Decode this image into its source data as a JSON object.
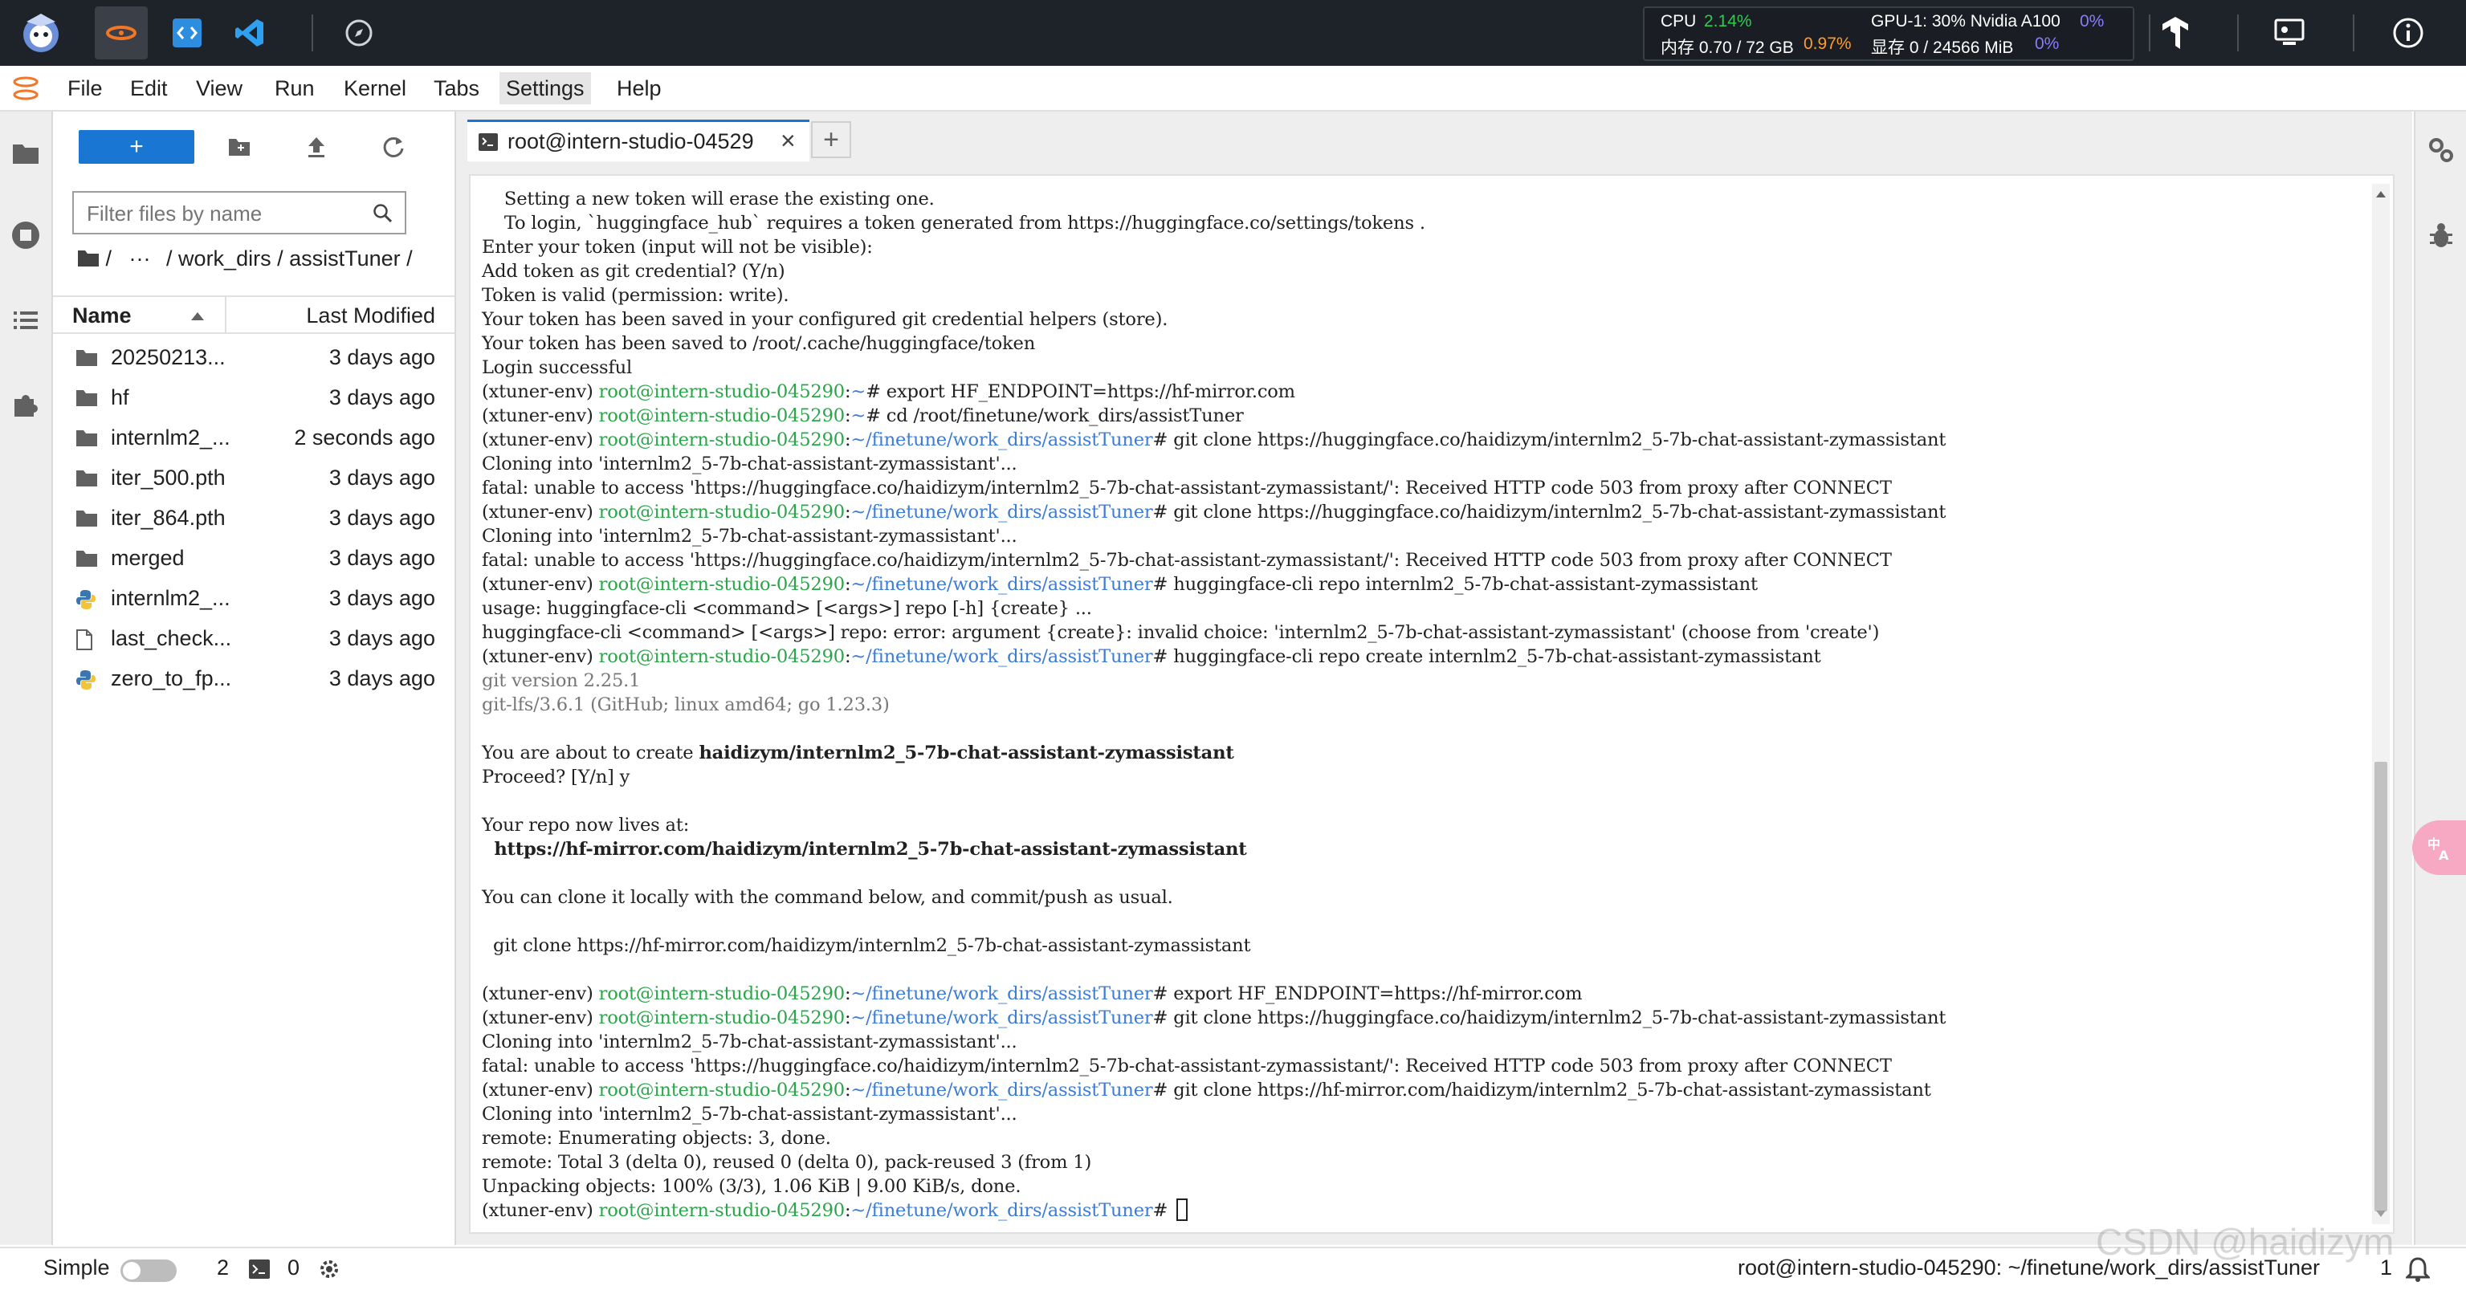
{
  "topbar": {
    "monitor": {
      "cpu_label": "CPU",
      "cpu_value": "2.14%",
      "mem_label": "内存 0.70 / 72 GB",
      "mem_value": "0.97%",
      "gpu_label": "GPU-1: 30% Nvidia A100",
      "gpu_value": "0%",
      "vram_label": "显存 0 / 24566 MiB",
      "vram_value": "0%"
    }
  },
  "menubar": {
    "items": [
      "File",
      "Edit",
      "View",
      "Run",
      "Kernel",
      "Tabs",
      "Settings",
      "Help"
    ]
  },
  "filebrowser": {
    "new_label": "+",
    "filter_placeholder": "Filter files by name",
    "breadcrumb": {
      "root": "/",
      "ellipsis": "···",
      "path": "/ work_dirs / assistTuner /"
    },
    "columns": {
      "name": "Name",
      "modified": "Last Modified"
    },
    "files": [
      {
        "name": "20250213...",
        "modified": "3 days ago",
        "type": "folder"
      },
      {
        "name": "hf",
        "modified": "3 days ago",
        "type": "folder"
      },
      {
        "name": "internlm2_...",
        "modified": "2 seconds ago",
        "type": "folder"
      },
      {
        "name": "iter_500.pth",
        "modified": "3 days ago",
        "type": "folder"
      },
      {
        "name": "iter_864.pth",
        "modified": "3 days ago",
        "type": "folder"
      },
      {
        "name": "merged",
        "modified": "3 days ago",
        "type": "folder"
      },
      {
        "name": "internlm2_...",
        "modified": "3 days ago",
        "type": "python"
      },
      {
        "name": "last_check...",
        "modified": "3 days ago",
        "type": "file"
      },
      {
        "name": "zero_to_fp...",
        "modified": "3 days ago",
        "type": "python"
      }
    ]
  },
  "main": {
    "tab_label": "root@intern-studio-04529",
    "tab_close": "×",
    "tab_add": "+"
  },
  "terminal": {
    "lines": [
      [
        {
          "t": "    Setting a new token will erase the existing one.",
          "c": "cmd"
        }
      ],
      [
        {
          "t": "    To login, `huggingface_hub` requires a token generated from https://huggingface.co/settings/tokens .",
          "c": "cmd"
        }
      ],
      [
        {
          "t": "Enter your token (input will not be visible):",
          "c": "cmd"
        }
      ],
      [
        {
          "t": "Add token as git credential? (Y/n)",
          "c": "cmd"
        }
      ],
      [
        {
          "t": "Token is valid (permission: write).",
          "c": "cmd"
        }
      ],
      [
        {
          "t": "Your token has been saved in your configured git credential helpers (store).",
          "c": "cmd"
        }
      ],
      [
        {
          "t": "Your token has been saved to /root/.cache/huggingface/token",
          "c": "cmd"
        }
      ],
      [
        {
          "t": "Login successful",
          "c": "cmd"
        }
      ],
      [
        {
          "t": "(xtuner-env) ",
          "c": "env"
        },
        {
          "t": "root@intern-studio-045290",
          "c": "usr"
        },
        {
          "t": ":",
          "c": "cmd"
        },
        {
          "t": "~",
          "c": "pth"
        },
        {
          "t": "# export HF_ENDPOINT=https://hf-mirror.com",
          "c": "cmd"
        }
      ],
      [
        {
          "t": "(xtuner-env) ",
          "c": "env"
        },
        {
          "t": "root@intern-studio-045290",
          "c": "usr"
        },
        {
          "t": ":",
          "c": "cmd"
        },
        {
          "t": "~",
          "c": "pth"
        },
        {
          "t": "# cd /root/finetune/work_dirs/assistTuner",
          "c": "cmd"
        }
      ],
      [
        {
          "t": "(xtuner-env) ",
          "c": "env"
        },
        {
          "t": "root@intern-studio-045290",
          "c": "usr"
        },
        {
          "t": ":",
          "c": "cmd"
        },
        {
          "t": "~/finetune/work_dirs/assistTuner",
          "c": "pth"
        },
        {
          "t": "# git clone https://huggingface.co/haidizym/internlm2_5-7b-chat-assistant-zymassistant",
          "c": "cmd"
        }
      ],
      [
        {
          "t": "Cloning into 'internlm2_5-7b-chat-assistant-zymassistant'...",
          "c": "cmd"
        }
      ],
      [
        {
          "t": "fatal: unable to access 'https://huggingface.co/haidizym/internlm2_5-7b-chat-assistant-zymassistant/': Received HTTP code 503 from proxy after CONNECT",
          "c": "cmd"
        }
      ],
      [
        {
          "t": "(xtuner-env) ",
          "c": "env"
        },
        {
          "t": "root@intern-studio-045290",
          "c": "usr"
        },
        {
          "t": ":",
          "c": "cmd"
        },
        {
          "t": "~/finetune/work_dirs/assistTuner",
          "c": "pth"
        },
        {
          "t": "# git clone https://huggingface.co/haidizym/internlm2_5-7b-chat-assistant-zymassistant",
          "c": "cmd"
        }
      ],
      [
        {
          "t": "Cloning into 'internlm2_5-7b-chat-assistant-zymassistant'...",
          "c": "cmd"
        }
      ],
      [
        {
          "t": "fatal: unable to access 'https://huggingface.co/haidizym/internlm2_5-7b-chat-assistant-zymassistant/': Received HTTP code 503 from proxy after CONNECT",
          "c": "cmd"
        }
      ],
      [
        {
          "t": "(xtuner-env) ",
          "c": "env"
        },
        {
          "t": "root@intern-studio-045290",
          "c": "usr"
        },
        {
          "t": ":",
          "c": "cmd"
        },
        {
          "t": "~/finetune/work_dirs/assistTuner",
          "c": "pth"
        },
        {
          "t": "# huggingface-cli repo internlm2_5-7b-chat-assistant-zymassistant",
          "c": "cmd"
        }
      ],
      [
        {
          "t": "usage: huggingface-cli <command> [<args>] repo [-h] {create} ...",
          "c": "cmd"
        }
      ],
      [
        {
          "t": "huggingface-cli <command> [<args>] repo: error: argument {create}: invalid choice: 'internlm2_5-7b-chat-assistant-zymassistant' (choose from 'create')",
          "c": "cmd"
        }
      ],
      [
        {
          "t": "(xtuner-env) ",
          "c": "env"
        },
        {
          "t": "root@intern-studio-045290",
          "c": "usr"
        },
        {
          "t": ":",
          "c": "cmd"
        },
        {
          "t": "~/finetune/work_dirs/assistTuner",
          "c": "pth"
        },
        {
          "t": "# huggingface-cli repo create internlm2_5-7b-chat-assistant-zymassistant",
          "c": "cmd"
        }
      ],
      [
        {
          "t": "git version 2.25.1",
          "c": "dim"
        }
      ],
      [
        {
          "t": "git-lfs/3.6.1 (GitHub; linux amd64; go 1.23.3)",
          "c": "dim"
        }
      ],
      [
        {
          "t": "",
          "c": "cmd"
        }
      ],
      [
        {
          "t": "You are about to create ",
          "c": "cmd"
        },
        {
          "t": "haidizym/internlm2_5-7b-chat-assistant-zymassistant",
          "c": "bld"
        }
      ],
      [
        {
          "t": "Proceed? [Y/n] y",
          "c": "cmd"
        }
      ],
      [
        {
          "t": "",
          "c": "cmd"
        }
      ],
      [
        {
          "t": "Your repo now lives at:",
          "c": "cmd"
        }
      ],
      [
        {
          "t": "  https://hf-mirror.com/haidizym/internlm2_5-7b-chat-assistant-zymassistant",
          "c": "bld"
        }
      ],
      [
        {
          "t": "",
          "c": "cmd"
        }
      ],
      [
        {
          "t": "You can clone it locally with the command below, and commit/push as usual.",
          "c": "cmd"
        }
      ],
      [
        {
          "t": "",
          "c": "cmd"
        }
      ],
      [
        {
          "t": "  git clone https://hf-mirror.com/haidizym/internlm2_5-7b-chat-assistant-zymassistant",
          "c": "cmd"
        }
      ],
      [
        {
          "t": "",
          "c": "cmd"
        }
      ],
      [
        {
          "t": "(xtuner-env) ",
          "c": "env"
        },
        {
          "t": "root@intern-studio-045290",
          "c": "usr"
        },
        {
          "t": ":",
          "c": "cmd"
        },
        {
          "t": "~/finetune/work_dirs/assistTuner",
          "c": "pth"
        },
        {
          "t": "# export HF_ENDPOINT=https://hf-mirror.com",
          "c": "cmd"
        }
      ],
      [
        {
          "t": "(xtuner-env) ",
          "c": "env"
        },
        {
          "t": "root@intern-studio-045290",
          "c": "usr"
        },
        {
          "t": ":",
          "c": "cmd"
        },
        {
          "t": "~/finetune/work_dirs/assistTuner",
          "c": "pth"
        },
        {
          "t": "# git clone https://huggingface.co/haidizym/internlm2_5-7b-chat-assistant-zymassistant",
          "c": "cmd"
        }
      ],
      [
        {
          "t": "Cloning into 'internlm2_5-7b-chat-assistant-zymassistant'...",
          "c": "cmd"
        }
      ],
      [
        {
          "t": "fatal: unable to access 'https://huggingface.co/haidizym/internlm2_5-7b-chat-assistant-zymassistant/': Received HTTP code 503 from proxy after CONNECT",
          "c": "cmd"
        }
      ],
      [
        {
          "t": "(xtuner-env) ",
          "c": "env"
        },
        {
          "t": "root@intern-studio-045290",
          "c": "usr"
        },
        {
          "t": ":",
          "c": "cmd"
        },
        {
          "t": "~/finetune/work_dirs/assistTuner",
          "c": "pth"
        },
        {
          "t": "# git clone https://hf-mirror.com/haidizym/internlm2_5-7b-chat-assistant-zymassistant",
          "c": "cmd"
        }
      ],
      [
        {
          "t": "Cloning into 'internlm2_5-7b-chat-assistant-zymassistant'...",
          "c": "cmd"
        }
      ],
      [
        {
          "t": "remote: Enumerating objects: 3, done.",
          "c": "cmd"
        }
      ],
      [
        {
          "t": "remote: Total 3 (delta 0), reused 0 (delta 0), pack-reused 3 (from 1)",
          "c": "cmd"
        }
      ],
      [
        {
          "t": "Unpacking objects: 100% (3/3), 1.06 KiB | 9.00 KiB/s, done.",
          "c": "cmd"
        }
      ],
      [
        {
          "t": "(xtuner-env) ",
          "c": "env"
        },
        {
          "t": "root@intern-studio-045290",
          "c": "usr"
        },
        {
          "t": ":",
          "c": "cmd"
        },
        {
          "t": "~/finetune/work_dirs/assistTuner",
          "c": "pth"
        },
        {
          "t": "# ",
          "c": "cmd"
        }
      ]
    ]
  },
  "statusbar": {
    "mode_label": "Simple",
    "kernels_count": "2",
    "terminals_count": "0",
    "path": "root@intern-studio-045290: ~/finetune/work_dirs/assistTuner",
    "notifications_count": "1"
  },
  "watermark": "CSDN @haidizym",
  "colors": {
    "accent": "#1976d2",
    "prompt_user": "#2aa54a",
    "prompt_path": "#3c7bd6",
    "cpu_ok": "#29d04a",
    "mem_warn": "#ff9c2a",
    "gpu_value": "#8a7bff"
  }
}
